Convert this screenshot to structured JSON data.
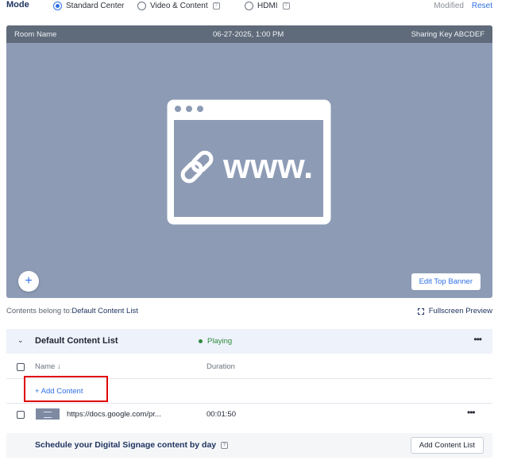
{
  "mode": {
    "label": "Mode",
    "options": [
      {
        "label": "Standard Center",
        "selected": true
      },
      {
        "label": "Video & Content",
        "selected": false
      },
      {
        "label": "HDMI",
        "selected": false
      }
    ],
    "modified_label": "Modified",
    "reset_label": "Reset"
  },
  "preview": {
    "room_name": "Room Name",
    "datetime": "06-27-2025, 1:00 PM",
    "sharing_key": "Sharing Key ABCDEF",
    "graphic_text": "www.",
    "graphic_icon": "link-icon",
    "edit_banner_label": "Edit Top Banner",
    "add_label": "+"
  },
  "contents_belong": {
    "prefix": "Contents belong to:",
    "list_name": "Default Content List"
  },
  "fullscreen_label": "Fullscreen Preview",
  "content_list": {
    "title": "Default Content List",
    "status": "Playing",
    "columns": {
      "name": "Name ↓",
      "duration": "Duration"
    },
    "add_content_label": "+ Add Content",
    "items": [
      {
        "url": "https://docs.google.com/pr...",
        "duration": "00:01:50"
      }
    ]
  },
  "schedule": {
    "text": "Schedule your Digital Signage content by day",
    "add_list_label": "Add Content List"
  },
  "colors": {
    "accent": "#2f6fe4",
    "preview_bg": "#8d9bb5",
    "playing": "#2e8b3d",
    "highlight": "#e00000"
  }
}
